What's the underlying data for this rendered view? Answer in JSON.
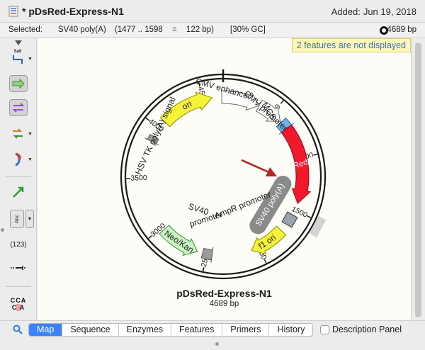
{
  "window": {
    "title": "* pDsRed-Express-N1",
    "added_label": "Added:",
    "added_date": "Jun 19, 2018"
  },
  "selection": {
    "label": "Selected:",
    "feature": "SV40 poly(A)",
    "range": "(1477 .. 1598",
    "equals": "=",
    "length": "122 bp)",
    "gc": "[30% GC]",
    "total": "4689 bp"
  },
  "toolbar": {
    "enzyme_label": "SalI",
    "abc_label": "Abc",
    "number_label": "(123)",
    "seq_top": "CCA",
    "seq_bottom": "C A"
  },
  "notice": "2 features are not displayed",
  "map": {
    "plasmid_name": "pDsRed-Express-N1",
    "plasmid_size": "4689 bp",
    "tick_labels": [
      "500",
      "1000",
      "1500",
      "2000",
      "2500",
      "3000",
      "3500",
      "4000",
      "4500"
    ],
    "features": {
      "ori": "ori",
      "cmv_enhancer": "CMV enhancer",
      "cmv_promoter": "CMV promoter",
      "mcs": "MCS",
      "dsred": "DsRed.T4",
      "sv40_polya": "SV40 poly(A)",
      "f1_ori": "f1 ori",
      "ampr_promoter": "AmpR promoter",
      "sv40_promoter_1": "SV40",
      "sv40_promoter_2": "promoter",
      "neo_kan": "Neo/Kan",
      "hsv_tk": "HSV TK poly(A) signal"
    },
    "colors": {
      "ori": "#f5f23a",
      "cmv": "#ffffff",
      "mcs": "#6fb2e8",
      "dsred": "#f2182b",
      "sv40_polya": "#8a8a8a",
      "f1_ori": "#f5f23a",
      "neo_kan": "#c9f4c4",
      "arrow": "#b42626"
    }
  },
  "tabs": [
    "Map",
    "Sequence",
    "Enzymes",
    "Features",
    "Primers",
    "History"
  ],
  "active_tab": "Map",
  "description_panel": "Description Panel"
}
